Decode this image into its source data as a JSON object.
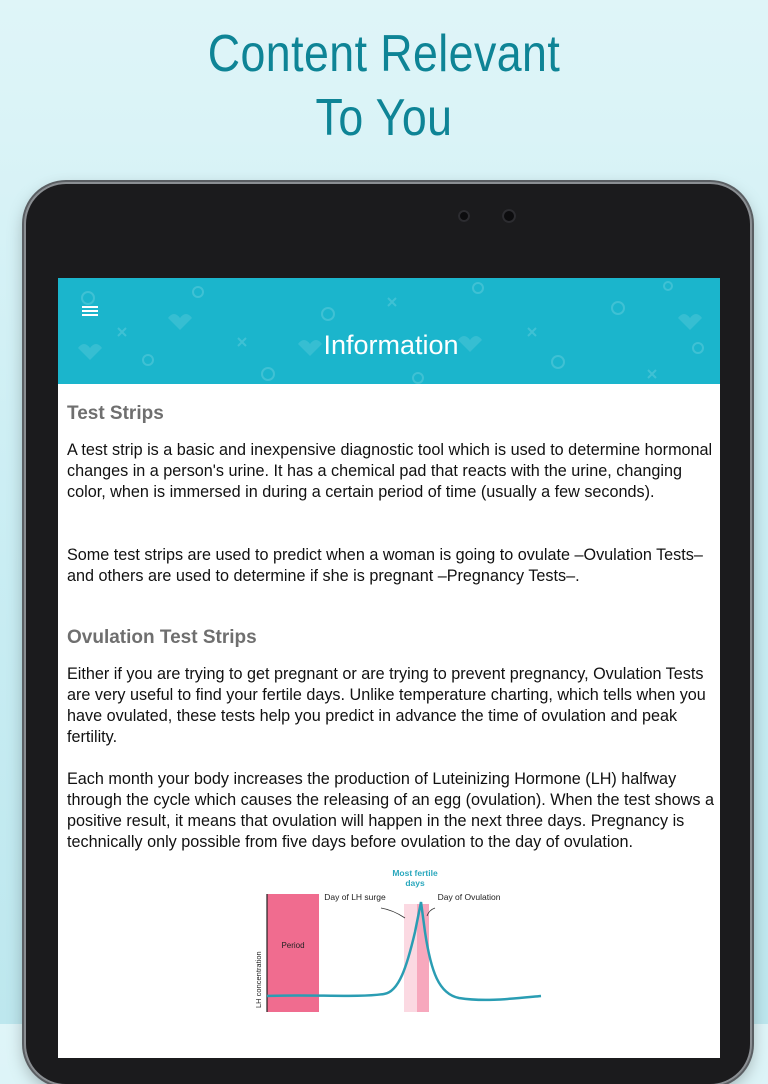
{
  "promo": {
    "headline_line1": "Content Relevant",
    "headline_line2": "To You",
    "color": "#0e8496"
  },
  "appbar": {
    "title": "Information",
    "menu_icon": "hamburger-menu-icon",
    "color": "#1bb5cc"
  },
  "sections": [
    {
      "title": "Test Strips",
      "paragraphs": [
        "A test strip is a basic and inexpensive diagnostic tool which is used to determine hormonal changes in a person's urine. It has a chemical pad that reacts with the urine, changing color, when is immersed in during a certain period of time (usually a few seconds).",
        "Some test strips are used to predict when a woman is going to ovulate –Ovulation Tests– and others are used to determine if she is pregnant –Pregnancy Tests–."
      ]
    },
    {
      "title": "Ovulation Test Strips",
      "paragraphs": [
        "Either if you are trying to get pregnant or are trying to prevent pregnancy, Ovulation Tests are very useful to find your fertile days. Unlike temperature charting, which tells when you have ovulated, these tests help you predict in advance the time of ovulation and peak fertility.",
        " Each month your body increases the production of Luteinizing Hormone (LH) halfway through the cycle which causes the releasing of an egg (ovulation). When the test shows a positive result, it means that ovulation will happen in the next three days. Pregnancy is technically only possible from five days before ovulation to the day of ovulation."
      ]
    }
  ],
  "diagram": {
    "most_fertile_line1": "Most fertile",
    "most_fertile_line2": "days",
    "lh_surge_label": "Day of LH surge",
    "ovulation_label": "Day of Ovulation",
    "period_label": "Period",
    "ylabel": "LH concentration",
    "colors": {
      "period": "#f06c8f",
      "fertile_light": "#fbd9e2",
      "fertile_dark": "#f7a8bd",
      "curve": "#2a9db3",
      "heading": "#2aa8bd"
    }
  }
}
